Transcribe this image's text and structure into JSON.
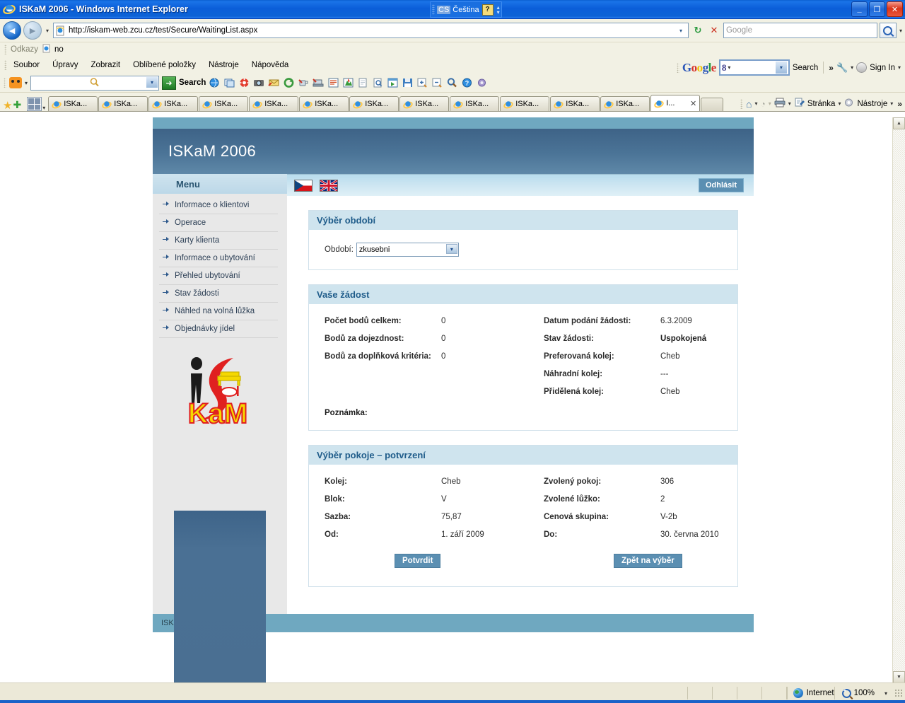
{
  "window": {
    "title": "ISKaM 2006 - Windows Internet Explorer",
    "minimize": "_",
    "maximize": "❐",
    "close": "✕"
  },
  "language_bar": {
    "code": "CS",
    "label": "Čeština",
    "kbd_glyph": "?"
  },
  "address_bar": {
    "url": "http://iskam-web.zcu.cz/test/Secure/WaitingList.aspx",
    "search_placeholder": "Google",
    "refresh_glyph": "↻",
    "stop_glyph": "✕",
    "back_glyph": "◄",
    "forward_glyph": "►"
  },
  "links_bar": {
    "label": "Odkazy",
    "item": "no"
  },
  "menu_bar": {
    "items": [
      "Soubor",
      "Úpravy",
      "Zobrazit",
      "Oblíbené položky",
      "Nástroje",
      "Nápověda"
    ]
  },
  "google_toolbar": {
    "logo": [
      "G",
      "o",
      "o",
      "g",
      "l",
      "e"
    ],
    "box_value": "8",
    "search_label": "Search",
    "sign_in": "Sign In",
    "chevron": "»"
  },
  "yahoo_toolbar": {
    "search_label": "Search",
    "go_glyph": "➜",
    "input_value": "",
    "icons": [
      "search-web-icon",
      "windows-icon",
      "lifesaver-icon",
      "camera-icon",
      "mail-icon",
      "refresh-green-icon",
      "cup-icon",
      "computer-icon",
      "list-icon",
      "bookmark-icon",
      "new-page-icon",
      "page-search-icon",
      "media-play-icon",
      "save-icon",
      "zoom-in-icon",
      "zoom-out-icon",
      "magnifier-icon",
      "help-icon",
      "settings-icon"
    ]
  },
  "tabs": {
    "items": [
      {
        "label": "ISKa...",
        "active": false
      },
      {
        "label": "ISKa...",
        "active": false
      },
      {
        "label": "ISKa...",
        "active": false
      },
      {
        "label": "ISKa...",
        "active": false
      },
      {
        "label": "ISKa...",
        "active": false
      },
      {
        "label": "ISKa...",
        "active": false
      },
      {
        "label": "ISKa...",
        "active": false
      },
      {
        "label": "ISKa...",
        "active": false
      },
      {
        "label": "ISKa...",
        "active": false
      },
      {
        "label": "ISKa...",
        "active": false
      },
      {
        "label": "ISKa...",
        "active": false
      },
      {
        "label": "ISKa...",
        "active": false
      },
      {
        "label": "I...",
        "active": true
      }
    ],
    "close_glyph": "✕"
  },
  "command_bar": {
    "page_label": "Stránka",
    "tools_label": "Nástroje",
    "overflow": "»"
  },
  "site": {
    "header_title": "ISKaM 2006",
    "menu_heading": "Menu",
    "menu_items": [
      "Informace o klientovi",
      "Operace",
      "Karty klienta",
      "Informace o ubytování",
      "Přehled ubytování",
      "Stav žádosti",
      "Náhled na volná lůžka",
      "Objednávky jídel"
    ],
    "logo_text": "KaM",
    "logout_label": "Odhlásit",
    "flags": [
      "flag-cz",
      "flag-gb"
    ],
    "footer": "ISKaM © ApS Brno 2006"
  },
  "panel_period": {
    "title": "Výběr období",
    "field_label": "Období:",
    "selected_value": "zkusebni"
  },
  "panel_request": {
    "title": "Vaše žádost",
    "left_rows": [
      {
        "label": "Počet bodů celkem:",
        "value": "0"
      },
      {
        "label": "Bodů za dojezdnost:",
        "value": "0"
      },
      {
        "label": "Bodů za doplňková kritéria:",
        "value": "0"
      }
    ],
    "right_rows": [
      {
        "label": "Datum podání žádosti:",
        "value": "6.3.2009"
      },
      {
        "label": "Stav žádosti:",
        "value": "Uspokojená"
      },
      {
        "label": "Preferovaná kolej:",
        "value": "Cheb"
      },
      {
        "label": "Náhradní kolej:",
        "value": "---"
      },
      {
        "label": "Přidělená kolej:",
        "value": "Cheb"
      }
    ],
    "note_label": "Poznámka:",
    "note_value": ""
  },
  "panel_room": {
    "title": "Výběr pokoje – potvrzení",
    "rows": [
      {
        "k": "Kolej:",
        "v": "Cheb",
        "k2": "Zvolený pokoj:",
        "v2": "306"
      },
      {
        "k": "Blok:",
        "v": "V",
        "k2": "Zvolené lůžko:",
        "v2": "2"
      },
      {
        "k": "Sazba:",
        "v": "75,87",
        "k2": "Cenová skupina:",
        "v2": "V-2b"
      },
      {
        "k": "Od:",
        "v": "1. září 2009",
        "k2": "Do:",
        "v2": "30. června 2010"
      }
    ],
    "confirm_label": "Potvrdit",
    "back_label": "Zpět na výběr"
  },
  "status_bar": {
    "zone": "Internet",
    "zoom": "100%",
    "dropdown_glyph": "▾"
  },
  "colors": {
    "accent_blue": "#4a7094",
    "panel_header": "#cfe4ee",
    "button_blue": "#5b8fb2",
    "footer_teal": "#6fa8c0",
    "title_blue": "#0d63d6"
  }
}
